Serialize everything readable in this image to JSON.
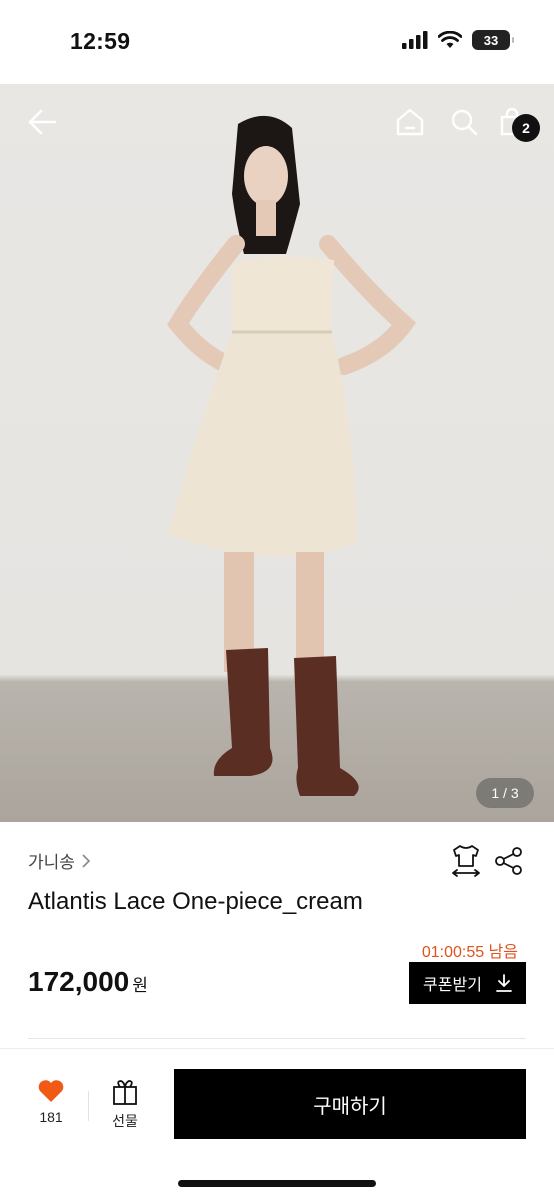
{
  "status_bar": {
    "time": "12:59",
    "battery": "33",
    "icons": [
      "cellular-signal-icon",
      "wifi-icon",
      "battery-icon"
    ]
  },
  "hero": {
    "icons": [
      "back-arrow-icon",
      "home-icon",
      "search-icon",
      "shopping-bag-icon"
    ],
    "cart_count": "2",
    "page_indicator": "1 / 3"
  },
  "product": {
    "brand": "가니송",
    "name": "Atlantis Lace One-piece_cream",
    "timer": "01:00:55 남음",
    "price": "172,000",
    "currency": "원",
    "coupon_label": "쿠폰받기",
    "icons": [
      "size-fit-icon",
      "share-icon",
      "download-icon",
      "chevron-right-icon"
    ]
  },
  "action_bar": {
    "like_count": "181",
    "gift_label": "선물",
    "buy_label": "구매하기",
    "icons": [
      "heart-icon",
      "gift-icon"
    ]
  },
  "colors": {
    "accent": "#e0531c",
    "heart": "#f05a14",
    "primary_button": "#000000"
  }
}
